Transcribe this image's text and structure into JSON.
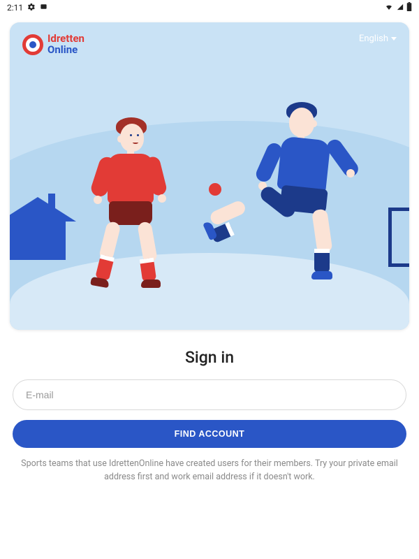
{
  "status": {
    "time": "2:11"
  },
  "brand": {
    "line1": "Idretten",
    "line2": "Online"
  },
  "language": {
    "label": "English"
  },
  "signin": {
    "heading": "Sign in",
    "email_placeholder": "E-mail",
    "button_label": "FIND ACCOUNT",
    "hint": "Sports teams that use IdrettenOnline have created users for their members. Try your private email address first and work email address if it doesn't work."
  },
  "colors": {
    "primary": "#2a56c6",
    "accent": "#e23b36"
  }
}
